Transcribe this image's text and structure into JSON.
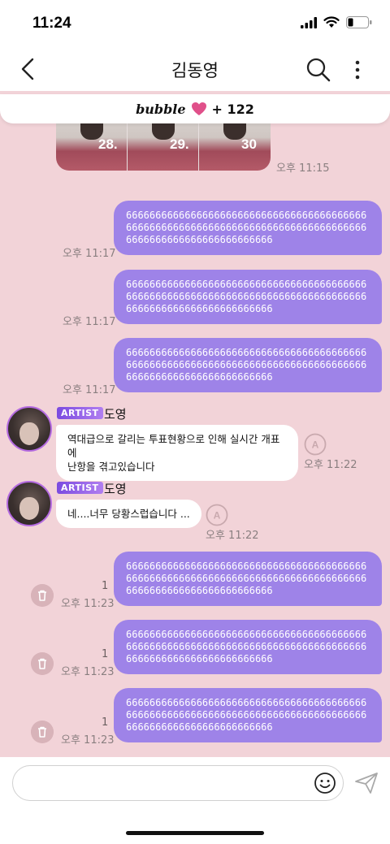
{
  "status_bar": {
    "time": "11:24"
  },
  "header": {
    "title": "김동영"
  },
  "banner": {
    "word": "bubble",
    "count": "+ 122"
  },
  "photos": [
    {
      "number": "28."
    },
    {
      "number": "29."
    },
    {
      "number": "30"
    }
  ],
  "photo_time": "오후 11:15",
  "messages": [
    {
      "type": "out",
      "text": "66666666666666666666666666666666666666666666666666666666666666666666666666666666666666666666666666666666666",
      "time": "오후 11:17"
    },
    {
      "type": "out",
      "text": "66666666666666666666666666666666666666666666666666666666666666666666666666666666666666666666666666666666666",
      "time": "오후 11:17"
    },
    {
      "type": "out",
      "text": "66666666666666666666666666666666666666666666666666666666666666666666666666666666666666666666666666666666666",
      "time": "오후 11:17"
    },
    {
      "type": "in",
      "badge": "ARTIST",
      "name": "도영",
      "text_line1": "역대급으로 갈리는 투표현황으로 인해 실시간 개표에",
      "text_line2": "난항을 겪고있습니다",
      "time": "오후 11:22"
    },
    {
      "type": "in",
      "badge": "ARTIST",
      "name": "도영",
      "text_line1": "네....너무 당황스럽습니다 ...",
      "time": "오후 11:22"
    },
    {
      "type": "out",
      "text": "66666666666666666666666666666666666666666666666666666666666666666666666666666666666666666666666666666666666",
      "time": "오후 11:23",
      "read_count": "1"
    },
    {
      "type": "out",
      "text": "66666666666666666666666666666666666666666666666666666666666666666666666666666666666666666666666666666666666",
      "time": "오후 11:23",
      "read_count": "1"
    },
    {
      "type": "out",
      "text": "66666666666666666666666666666666666666666666666666666666666666666666666666666666666666666666666666666666666",
      "time": "오후 11:23",
      "read_count": "1"
    }
  ],
  "input": {
    "placeholder": ""
  },
  "colors": {
    "background": "#f2d3d8",
    "bubble_out": "#9e83e8",
    "accent": "#7b4be0",
    "heart": "#e0508a"
  }
}
